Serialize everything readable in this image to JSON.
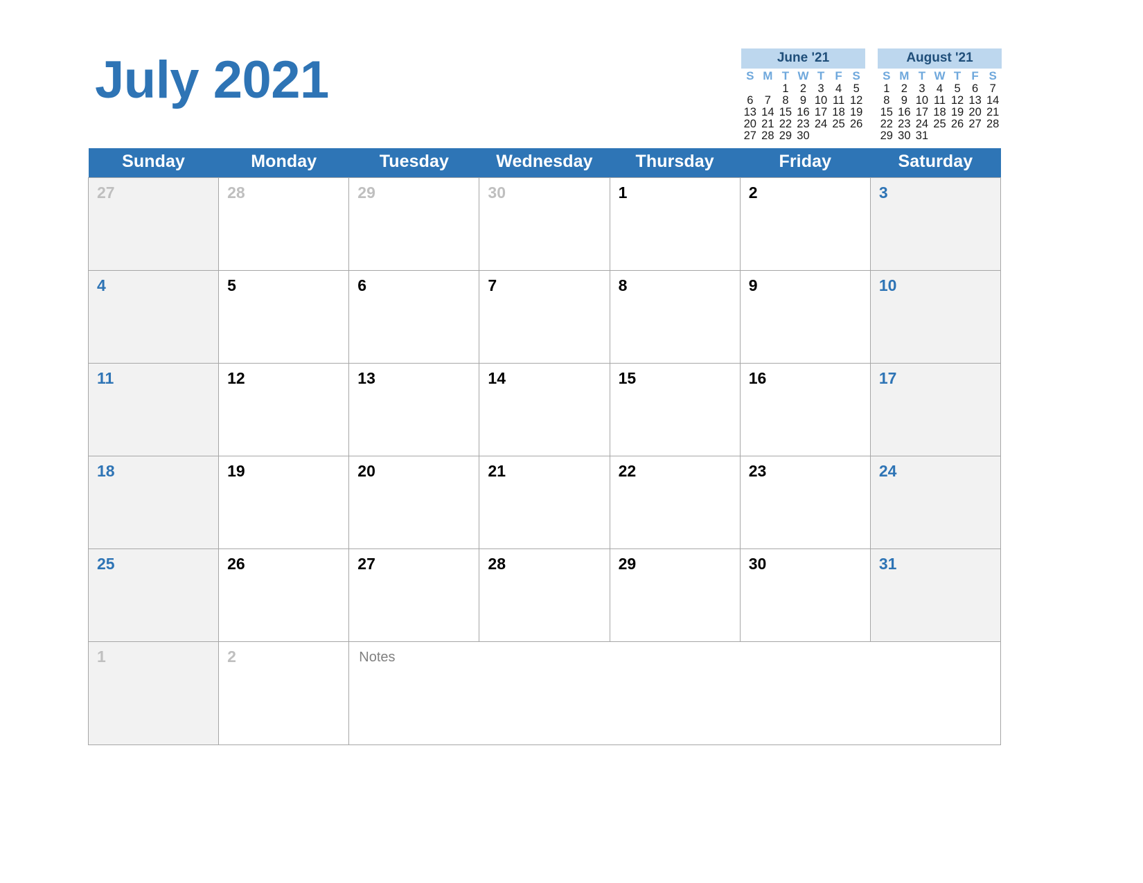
{
  "title": "July 2021",
  "mini_calendars": [
    {
      "name": "june",
      "label": "June '21",
      "dow": [
        "S",
        "M",
        "T",
        "W",
        "T",
        "F",
        "S"
      ],
      "weeks": [
        [
          "",
          "",
          "1",
          "2",
          "3",
          "4",
          "5"
        ],
        [
          "6",
          "7",
          "8",
          "9",
          "10",
          "11",
          "12"
        ],
        [
          "13",
          "14",
          "15",
          "16",
          "17",
          "18",
          "19"
        ],
        [
          "20",
          "21",
          "22",
          "23",
          "24",
          "25",
          "26"
        ],
        [
          "27",
          "28",
          "29",
          "30",
          "",
          "",
          ""
        ]
      ]
    },
    {
      "name": "august",
      "label": "August '21",
      "dow": [
        "S",
        "M",
        "T",
        "W",
        "T",
        "F",
        "S"
      ],
      "weeks": [
        [
          "1",
          "2",
          "3",
          "4",
          "5",
          "6",
          "7"
        ],
        [
          "8",
          "9",
          "10",
          "11",
          "12",
          "13",
          "14"
        ],
        [
          "15",
          "16",
          "17",
          "18",
          "19",
          "20",
          "21"
        ],
        [
          "22",
          "23",
          "24",
          "25",
          "26",
          "27",
          "28"
        ],
        [
          "29",
          "30",
          "31",
          "",
          "",
          "",
          ""
        ]
      ]
    }
  ],
  "weekday_headers": [
    "Sunday",
    "Monday",
    "Tuesday",
    "Wednesday",
    "Thursday",
    "Friday",
    "Saturday"
  ],
  "weeks": [
    [
      {
        "num": "27",
        "other": true
      },
      {
        "num": "28",
        "other": true
      },
      {
        "num": "29",
        "other": true
      },
      {
        "num": "30",
        "other": true
      },
      {
        "num": "1",
        "other": false
      },
      {
        "num": "2",
        "other": false
      },
      {
        "num": "3",
        "other": false
      }
    ],
    [
      {
        "num": "4",
        "other": false
      },
      {
        "num": "5",
        "other": false
      },
      {
        "num": "6",
        "other": false
      },
      {
        "num": "7",
        "other": false
      },
      {
        "num": "8",
        "other": false
      },
      {
        "num": "9",
        "other": false
      },
      {
        "num": "10",
        "other": false
      }
    ],
    [
      {
        "num": "11",
        "other": false
      },
      {
        "num": "12",
        "other": false
      },
      {
        "num": "13",
        "other": false
      },
      {
        "num": "14",
        "other": false
      },
      {
        "num": "15",
        "other": false
      },
      {
        "num": "16",
        "other": false
      },
      {
        "num": "17",
        "other": false
      }
    ],
    [
      {
        "num": "18",
        "other": false
      },
      {
        "num": "19",
        "other": false
      },
      {
        "num": "20",
        "other": false
      },
      {
        "num": "21",
        "other": false
      },
      {
        "num": "22",
        "other": false
      },
      {
        "num": "23",
        "other": false
      },
      {
        "num": "24",
        "other": false
      }
    ],
    [
      {
        "num": "25",
        "other": false
      },
      {
        "num": "26",
        "other": false
      },
      {
        "num": "27",
        "other": false
      },
      {
        "num": "28",
        "other": false
      },
      {
        "num": "29",
        "other": false
      },
      {
        "num": "30",
        "other": false
      },
      {
        "num": "31",
        "other": false
      }
    ]
  ],
  "notes_row": {
    "cells": [
      {
        "num": "1",
        "other": true
      },
      {
        "num": "2",
        "other": true
      }
    ],
    "notes_label": "Notes"
  },
  "colors": {
    "title_blue": "#2E74B5",
    "header_blue": "#2E75B6",
    "mini_header_blue": "#BDD7EE",
    "mini_dow_blue": "#6FA8DC",
    "weekend_bg": "#F2F2F2",
    "other_month_gray": "#BFBFBF",
    "border_gray": "#A6A6A6",
    "notes_gray": "#808080"
  }
}
